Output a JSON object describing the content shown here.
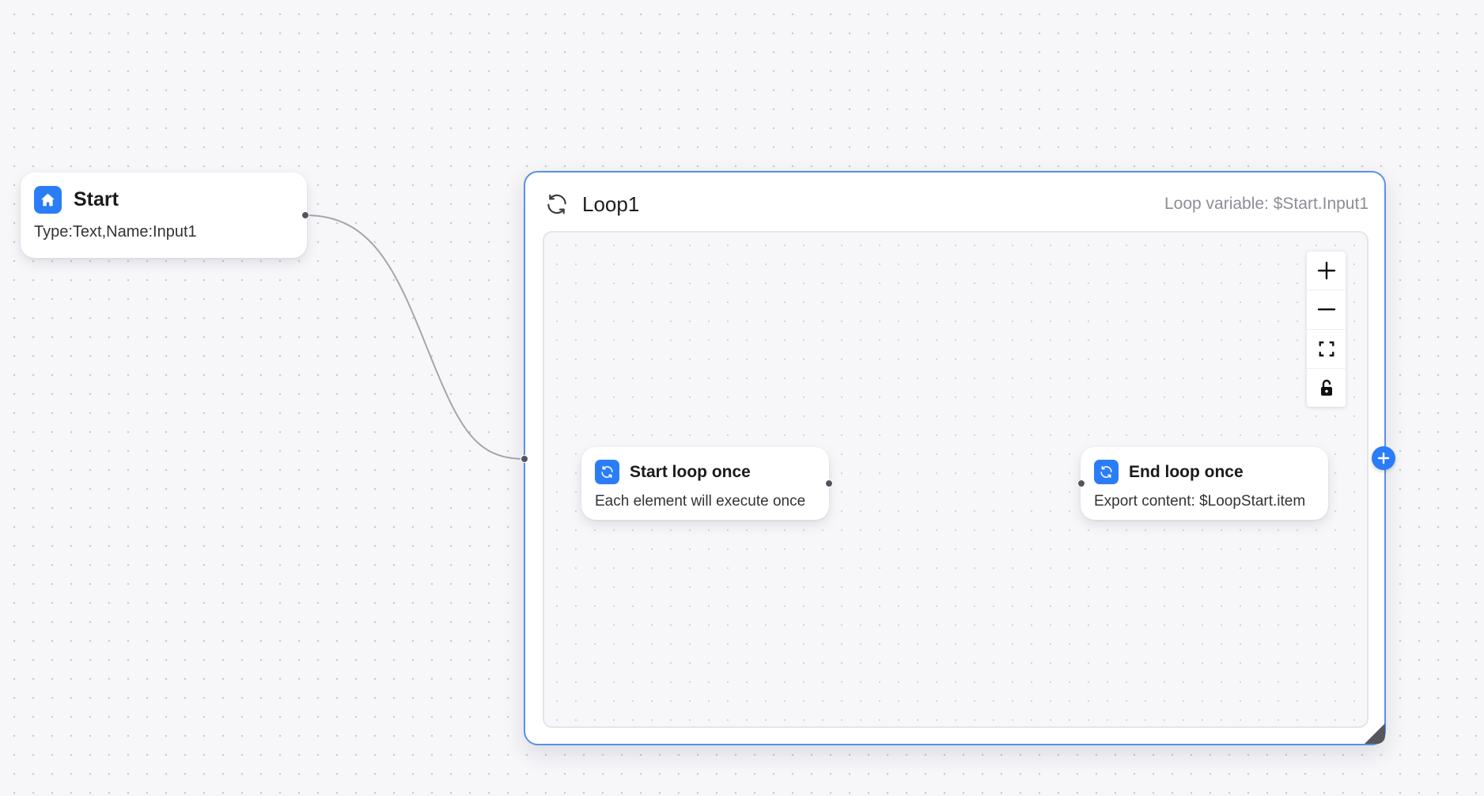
{
  "flow": {
    "start_node": {
      "title": "Start",
      "description": "Type:Text,Name:Input1",
      "icon": "home-icon"
    },
    "loop_group": {
      "title": "Loop1",
      "loop_variable": "Loop variable: $Start.Input1",
      "icon": "refresh-icon",
      "inner_nodes": [
        {
          "title": "Start loop once",
          "description": "Each element will execute once",
          "icon": "refresh-icon"
        },
        {
          "title": "End loop once",
          "description": "Export content: $LoopStart.item",
          "icon": "refresh-icon"
        }
      ]
    },
    "zoom_controls": [
      "plus-icon",
      "minus-icon",
      "fit-view-icon",
      "lock-icon"
    ]
  },
  "colors": {
    "accent": "#2b7df7",
    "group_border": "#5b8fe8",
    "edge": "#a5a6ad",
    "canvas_background": "#f7f7fa"
  }
}
